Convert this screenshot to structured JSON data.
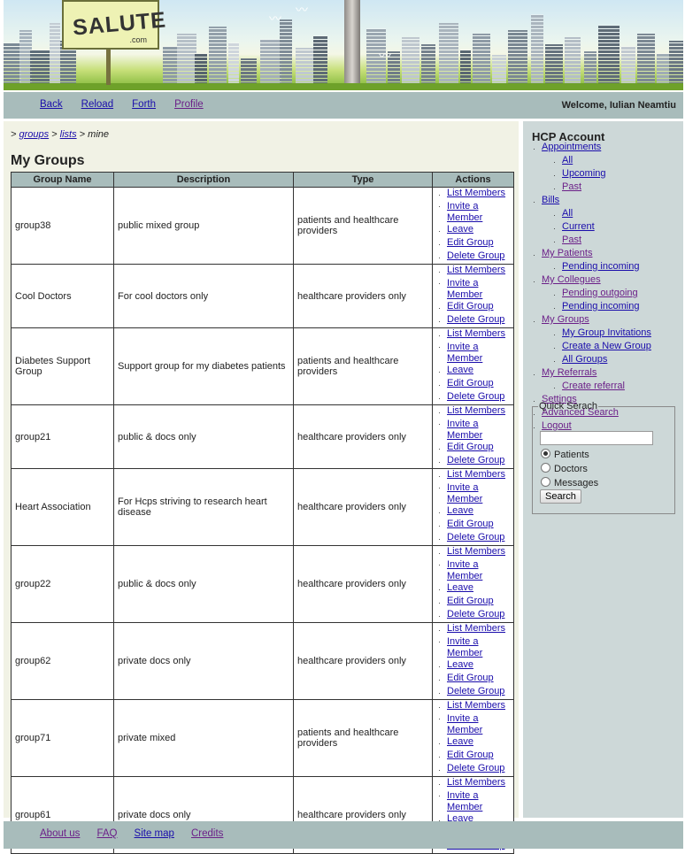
{
  "brand": {
    "logo_text": "SALUTE",
    "logo_suffix": ".com"
  },
  "nav": {
    "back": "Back",
    "reload": "Reload",
    "forth": "Forth",
    "profile": "Profile",
    "welcome": "Welcome, Iulian Neamtiu"
  },
  "breadcrumb": {
    "sep1": "> ",
    "groups": "groups",
    "sep2": " > ",
    "lists": "lists",
    "sep3": " > mine"
  },
  "page_title": "My Groups",
  "table": {
    "headers": [
      "Group Name",
      "Description",
      "Type",
      "Actions"
    ],
    "actions": {
      "list_members": "List Members",
      "invite_1": "Invite a",
      "invite_2": "Member",
      "leave": "Leave",
      "edit": "Edit Group",
      "delete": "Delete Group"
    },
    "rows": [
      {
        "name": "group38",
        "description": "public mixed group",
        "type": "patients and healthcare providers"
      },
      {
        "name": "Cool Doctors",
        "description": "For cool doctors only",
        "type": "healthcare providers only"
      },
      {
        "name": "Diabetes Support Group",
        "description": "Support group for my diabetes patients",
        "type": "patients and healthcare providers"
      },
      {
        "name": "group21",
        "description": "public & docs only",
        "type": "healthcare providers only"
      },
      {
        "name": "Heart Association",
        "description": "For Hcps striving to research heart disease",
        "type": "healthcare providers only"
      },
      {
        "name": "group22",
        "description": "public & docs only",
        "type": "healthcare providers only"
      },
      {
        "name": "group62",
        "description": "private docs only",
        "type": "healthcare providers only"
      },
      {
        "name": "group71",
        "description": "private mixed",
        "type": "patients and healthcare providers"
      },
      {
        "name": "group61",
        "description": "private docs only",
        "type": "healthcare providers only"
      }
    ]
  },
  "sidebar": {
    "title": "HCP Account",
    "appointments": "Appointments",
    "all": "All",
    "upcoming": "Upcoming",
    "past": "Past",
    "bills": "Bills",
    "current": "Current",
    "my_patients": "My Patients",
    "pending_incoming": "Pending incoming",
    "my_colleagues": "My Collegues",
    "pending_outgoing": "Pending outgoing",
    "my_groups": "My Groups",
    "my_group_invitations": "My Group Invitations",
    "create_group": "Create a New Group",
    "all_groups": "All Groups",
    "my_referrals": "My Referrals",
    "create_referral": "Create referral",
    "settings": "Settings",
    "advanced_search": "Advanced Search",
    "logout": "Logout"
  },
  "quick_search": {
    "legend": "Quick Serach",
    "input_value": "",
    "options": [
      "Patients",
      "Doctors",
      "Messages"
    ],
    "selected": "Patients",
    "button": "Search"
  },
  "footer": {
    "about": "About us",
    "faq": "FAQ",
    "sitemap": "Site map",
    "credits": "Credits"
  },
  "colors": {
    "nav_bar": "#a8bcbb",
    "main_bg": "#f1f2e5",
    "sidebar_bg": "#cdd8d8",
    "link": "#1a0dab",
    "visited_link": "#6b1f88"
  }
}
